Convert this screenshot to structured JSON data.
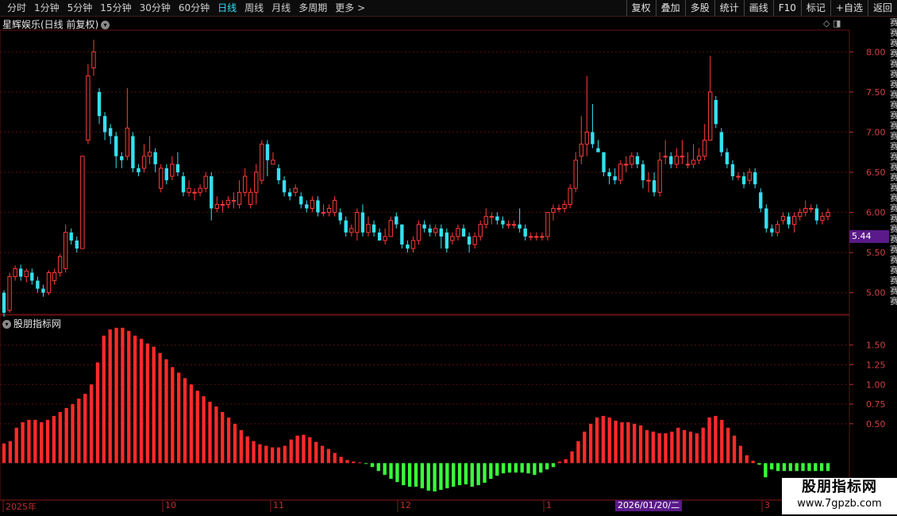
{
  "toolbar": {
    "periods": [
      "分时",
      "1分钟",
      "5分钟",
      "15分钟",
      "30分钟",
      "60分钟",
      "日线",
      "周线",
      "月线",
      "多周期",
      "更多 >"
    ],
    "active_period": "日线",
    "buttons": [
      "复权",
      "叠加",
      "多股",
      "统计",
      "画线",
      "F10",
      "标记",
      "+自选",
      "返回"
    ]
  },
  "main_chart": {
    "title": "星辉娱乐(日线 前复权)",
    "current_price_tag": "5.44",
    "y_labels": [
      "8.00",
      "7.50",
      "7.00",
      "6.50",
      "6.00",
      "5.50",
      "5.00"
    ]
  },
  "indicator": {
    "title": "股朋指标网",
    "y_labels": [
      "1.50",
      "1.25",
      "1.00",
      "0.75",
      "0.50"
    ]
  },
  "x_axis": {
    "labels": [
      "2025年",
      "10",
      "11",
      "12",
      "1",
      "2026/01/20/二",
      "3"
    ]
  },
  "watermark": {
    "title": "股朋指标网",
    "url": "www.7gpzb.com"
  },
  "colors": {
    "up": "#ff3b3b",
    "down": "#33e1ef",
    "hist_pos": "#ff2a2a",
    "hist_neg": "#39ff39",
    "grid": "#5a1010"
  },
  "chart_data": {
    "type": "candlestick",
    "ylim": [
      4.75,
      8.25
    ],
    "candles": [
      [
        5.0,
        4.75,
        5.03,
        4.7
      ],
      [
        4.78,
        5.2,
        5.25,
        4.75
      ],
      [
        5.2,
        5.3,
        5.34,
        5.15
      ],
      [
        5.3,
        5.2,
        5.35,
        5.15
      ],
      [
        5.2,
        5.27,
        5.3,
        5.13
      ],
      [
        5.25,
        5.15,
        5.3,
        5.1
      ],
      [
        5.15,
        5.05,
        5.2,
        5.0
      ],
      [
        5.05,
        5.0,
        5.1,
        4.95
      ],
      [
        5.0,
        5.25,
        5.28,
        4.97
      ],
      [
        5.15,
        5.25,
        5.3,
        5.1
      ],
      [
        5.25,
        5.45,
        5.48,
        5.2
      ],
      [
        5.3,
        5.75,
        5.85,
        5.25
      ],
      [
        5.75,
        5.65,
        5.8,
        5.6
      ],
      [
        5.65,
        5.55,
        5.7,
        5.5
      ],
      [
        5.55,
        6.7,
        6.7,
        5.55
      ],
      [
        6.9,
        7.7,
        7.85,
        6.85
      ],
      [
        7.8,
        8.0,
        8.15,
        7.7
      ],
      [
        7.5,
        7.2,
        7.55,
        7.1
      ],
      [
        7.2,
        7.0,
        7.25,
        6.9
      ],
      [
        7.05,
        6.95,
        7.1,
        6.85
      ],
      [
        6.95,
        6.7,
        7.0,
        6.55
      ],
      [
        6.7,
        6.65,
        6.75,
        6.55
      ],
      [
        6.7,
        7.05,
        7.55,
        6.65
      ],
      [
        6.95,
        6.55,
        7.0,
        6.5
      ],
      [
        6.55,
        6.5,
        6.6,
        6.45
      ],
      [
        6.55,
        6.7,
        6.85,
        6.5
      ],
      [
        6.7,
        6.75,
        6.95,
        6.6
      ],
      [
        6.75,
        6.6,
        6.8,
        6.5
      ],
      [
        6.3,
        6.55,
        6.6,
        6.25
      ],
      [
        6.55,
        6.4,
        6.6,
        6.35
      ],
      [
        6.45,
        6.6,
        6.7,
        6.4
      ],
      [
        6.6,
        6.5,
        6.75,
        6.45
      ],
      [
        6.45,
        6.25,
        6.5,
        6.2
      ],
      [
        6.25,
        6.3,
        6.4,
        6.2
      ],
      [
        6.25,
        6.25,
        6.3,
        6.15
      ],
      [
        6.25,
        6.3,
        6.35,
        6.2
      ],
      [
        6.3,
        6.45,
        6.5,
        6.25
      ],
      [
        6.45,
        6.05,
        6.5,
        5.9
      ],
      [
        6.05,
        6.1,
        6.2,
        6.0
      ],
      [
        6.1,
        6.1,
        6.15,
        6.0
      ],
      [
        6.1,
        6.15,
        6.2,
        6.05
      ],
      [
        6.15,
        6.15,
        6.25,
        6.05
      ],
      [
        6.1,
        6.25,
        6.4,
        6.05
      ],
      [
        6.25,
        6.45,
        6.55,
        6.2
      ],
      [
        6.1,
        6.25,
        6.3,
        6.05
      ],
      [
        6.25,
        6.5,
        6.6,
        6.1
      ],
      [
        6.4,
        6.85,
        6.9,
        6.35
      ],
      [
        6.85,
        6.65,
        6.9,
        6.45
      ],
      [
        6.6,
        6.65,
        6.75,
        6.6
      ],
      [
        6.55,
        6.4,
        6.6,
        6.35
      ],
      [
        6.4,
        6.25,
        6.45,
        6.2
      ],
      [
        6.25,
        6.2,
        6.3,
        6.15
      ],
      [
        6.25,
        6.3,
        6.35,
        6.2
      ],
      [
        6.2,
        6.1,
        6.25,
        6.05
      ],
      [
        6.1,
        6.05,
        6.15,
        6.0
      ],
      [
        6.05,
        6.15,
        6.2,
        6.0
      ],
      [
        6.15,
        6.0,
        6.2,
        5.95
      ],
      [
        6.0,
        6.0,
        6.1,
        5.95
      ],
      [
        6.0,
        6.05,
        6.1,
        5.95
      ],
      [
        6.0,
        6.15,
        6.2,
        5.95
      ],
      [
        6.0,
        5.9,
        6.05,
        5.85
      ],
      [
        5.9,
        5.75,
        5.95,
        5.7
      ],
      [
        5.75,
        5.8,
        5.85,
        5.7
      ],
      [
        5.75,
        6.0,
        6.05,
        5.65
      ],
      [
        6.0,
        5.75,
        6.1,
        5.7
      ],
      [
        5.75,
        5.85,
        5.95,
        5.7
      ],
      [
        5.85,
        5.75,
        5.9,
        5.7
      ],
      [
        5.75,
        5.65,
        5.8,
        5.65
      ],
      [
        5.65,
        5.7,
        5.8,
        5.6
      ],
      [
        5.7,
        5.9,
        5.95,
        5.7
      ],
      [
        5.95,
        5.85,
        6.0,
        5.8
      ],
      [
        5.85,
        5.6,
        5.85,
        5.55
      ],
      [
        5.6,
        5.55,
        5.65,
        5.5
      ],
      [
        5.55,
        5.65,
        5.7,
        5.5
      ],
      [
        5.65,
        5.85,
        5.9,
        5.6
      ],
      [
        5.85,
        5.8,
        5.9,
        5.75
      ],
      [
        5.8,
        5.75,
        5.85,
        5.7
      ],
      [
        5.75,
        5.8,
        5.85,
        5.7
      ],
      [
        5.8,
        5.7,
        5.85,
        5.55
      ],
      [
        5.75,
        5.55,
        5.8,
        5.5
      ],
      [
        5.65,
        5.7,
        5.75,
        5.6
      ],
      [
        5.7,
        5.8,
        5.85,
        5.65
      ],
      [
        5.8,
        5.7,
        5.85,
        5.7
      ],
      [
        5.7,
        5.6,
        5.75,
        5.5
      ],
      [
        5.6,
        5.7,
        5.75,
        5.55
      ],
      [
        5.7,
        5.85,
        5.9,
        5.65
      ],
      [
        5.85,
        5.95,
        6.05,
        5.8
      ],
      [
        5.95,
        5.95,
        6.0,
        5.85
      ],
      [
        5.95,
        5.9,
        6.0,
        5.85
      ],
      [
        5.9,
        5.85,
        5.95,
        5.8
      ],
      [
        5.85,
        5.85,
        5.9,
        5.8
      ],
      [
        5.85,
        5.85,
        5.9,
        5.8
      ],
      [
        5.85,
        5.8,
        6.05,
        5.75
      ],
      [
        5.8,
        5.7,
        5.85,
        5.65
      ],
      [
        5.7,
        5.7,
        5.75,
        5.65
      ],
      [
        5.7,
        5.7,
        5.75,
        5.65
      ],
      [
        5.7,
        5.7,
        5.75,
        5.65
      ],
      [
        5.7,
        6.0,
        6.0,
        5.65
      ],
      [
        6.0,
        6.05,
        6.1,
        5.9
      ],
      [
        6.05,
        6.05,
        6.1,
        6.0
      ],
      [
        6.05,
        6.1,
        6.15,
        6.0
      ],
      [
        6.1,
        6.3,
        6.35,
        6.05
      ],
      [
        6.3,
        6.65,
        6.75,
        6.25
      ],
      [
        6.7,
        6.85,
        7.2,
        6.6
      ],
      [
        6.85,
        7.0,
        7.7,
        6.7
      ],
      [
        7.0,
        6.85,
        7.35,
        6.8
      ],
      [
        6.8,
        6.75,
        6.9,
        6.75
      ],
      [
        6.75,
        6.5,
        6.75,
        6.45
      ],
      [
        6.5,
        6.45,
        6.55,
        6.35
      ],
      [
        6.45,
        6.4,
        6.55,
        6.35
      ],
      [
        6.4,
        6.6,
        6.65,
        6.35
      ],
      [
        6.6,
        6.6,
        6.7,
        6.5
      ],
      [
        6.6,
        6.7,
        6.75,
        6.55
      ],
      [
        6.7,
        6.6,
        6.75,
        6.55
      ],
      [
        6.6,
        6.4,
        6.65,
        6.3
      ],
      [
        6.4,
        6.4,
        6.5,
        6.25
      ],
      [
        6.4,
        6.25,
        6.5,
        6.2
      ],
      [
        6.25,
        6.65,
        6.75,
        6.2
      ],
      [
        6.7,
        6.7,
        6.9,
        6.6
      ],
      [
        6.7,
        6.6,
        6.75,
        6.55
      ],
      [
        6.6,
        6.7,
        6.8,
        6.55
      ],
      [
        6.7,
        6.7,
        6.9,
        6.6
      ],
      [
        6.6,
        6.6,
        6.75,
        6.55
      ],
      [
        6.6,
        6.65,
        6.85,
        6.55
      ],
      [
        6.65,
        6.7,
        6.8,
        6.6
      ],
      [
        6.7,
        6.9,
        7.1,
        6.65
      ],
      [
        6.9,
        7.5,
        7.95,
        6.9
      ],
      [
        7.4,
        7.1,
        7.45,
        7.05
      ],
      [
        7.0,
        6.75,
        7.05,
        6.7
      ],
      [
        6.75,
        6.6,
        6.8,
        6.55
      ],
      [
        6.6,
        6.45,
        6.65,
        6.4
      ],
      [
        6.45,
        6.45,
        6.5,
        6.4
      ],
      [
        6.45,
        6.35,
        6.5,
        6.3
      ],
      [
        6.4,
        6.5,
        6.55,
        6.35
      ],
      [
        6.5,
        6.35,
        6.55,
        6.3
      ],
      [
        6.25,
        6.05,
        6.3,
        6.0
      ],
      [
        6.05,
        5.8,
        6.1,
        5.75
      ],
      [
        5.8,
        5.75,
        5.85,
        5.7
      ],
      [
        5.75,
        5.85,
        5.9,
        5.7
      ],
      [
        5.9,
        5.95,
        6.0,
        5.85
      ],
      [
        5.95,
        5.85,
        6.0,
        5.8
      ],
      [
        5.85,
        5.95,
        6.0,
        5.75
      ],
      [
        5.95,
        6.0,
        6.05,
        5.9
      ],
      [
        6.0,
        6.05,
        6.15,
        5.95
      ],
      [
        6.05,
        6.05,
        6.1,
        6.0
      ],
      [
        6.05,
        5.9,
        6.1,
        5.85
      ],
      [
        5.9,
        5.95,
        6.0,
        5.85
      ],
      [
        5.95,
        6.0,
        6.05,
        5.9
      ]
    ],
    "histogram": {
      "ylim": [
        -0.45,
        1.85
      ],
      "values": [
        0.25,
        0.28,
        0.45,
        0.52,
        0.55,
        0.55,
        0.52,
        0.55,
        0.6,
        0.65,
        0.7,
        0.75,
        0.82,
        0.88,
        1.0,
        1.28,
        1.62,
        1.7,
        1.72,
        1.72,
        1.68,
        1.62,
        1.58,
        1.52,
        1.48,
        1.4,
        1.32,
        1.22,
        1.15,
        1.08,
        1.0,
        0.92,
        0.85,
        0.78,
        0.72,
        0.65,
        0.58,
        0.5,
        0.42,
        0.34,
        0.28,
        0.24,
        0.22,
        0.2,
        0.2,
        0.22,
        0.3,
        0.35,
        0.36,
        0.33,
        0.27,
        0.22,
        0.18,
        0.13,
        0.08,
        0.04,
        0.02,
        0.01,
        -0.01,
        -0.05,
        -0.1,
        -0.15,
        -0.2,
        -0.24,
        -0.28,
        -0.3,
        -0.3,
        -0.32,
        -0.35,
        -0.36,
        -0.34,
        -0.32,
        -0.3,
        -0.28,
        -0.27,
        -0.3,
        -0.28,
        -0.25,
        -0.2,
        -0.16,
        -0.13,
        -0.12,
        -0.12,
        -0.12,
        -0.13,
        -0.15,
        -0.12,
        -0.08,
        -0.05,
        0.02,
        0.05,
        0.15,
        0.28,
        0.4,
        0.5,
        0.58,
        0.6,
        0.58,
        0.54,
        0.52,
        0.52,
        0.5,
        0.48,
        0.42,
        0.4,
        0.38,
        0.38,
        0.4,
        0.45,
        0.42,
        0.4,
        0.38,
        0.45,
        0.58,
        0.6,
        0.55,
        0.45,
        0.35,
        0.22,
        0.1,
        0.03,
        -0.02,
        -0.18,
        -0.08,
        -0.1,
        -0.1,
        -0.1,
        -0.1,
        -0.1,
        -0.1,
        -0.1,
        -0.1,
        -0.1
      ]
    }
  }
}
